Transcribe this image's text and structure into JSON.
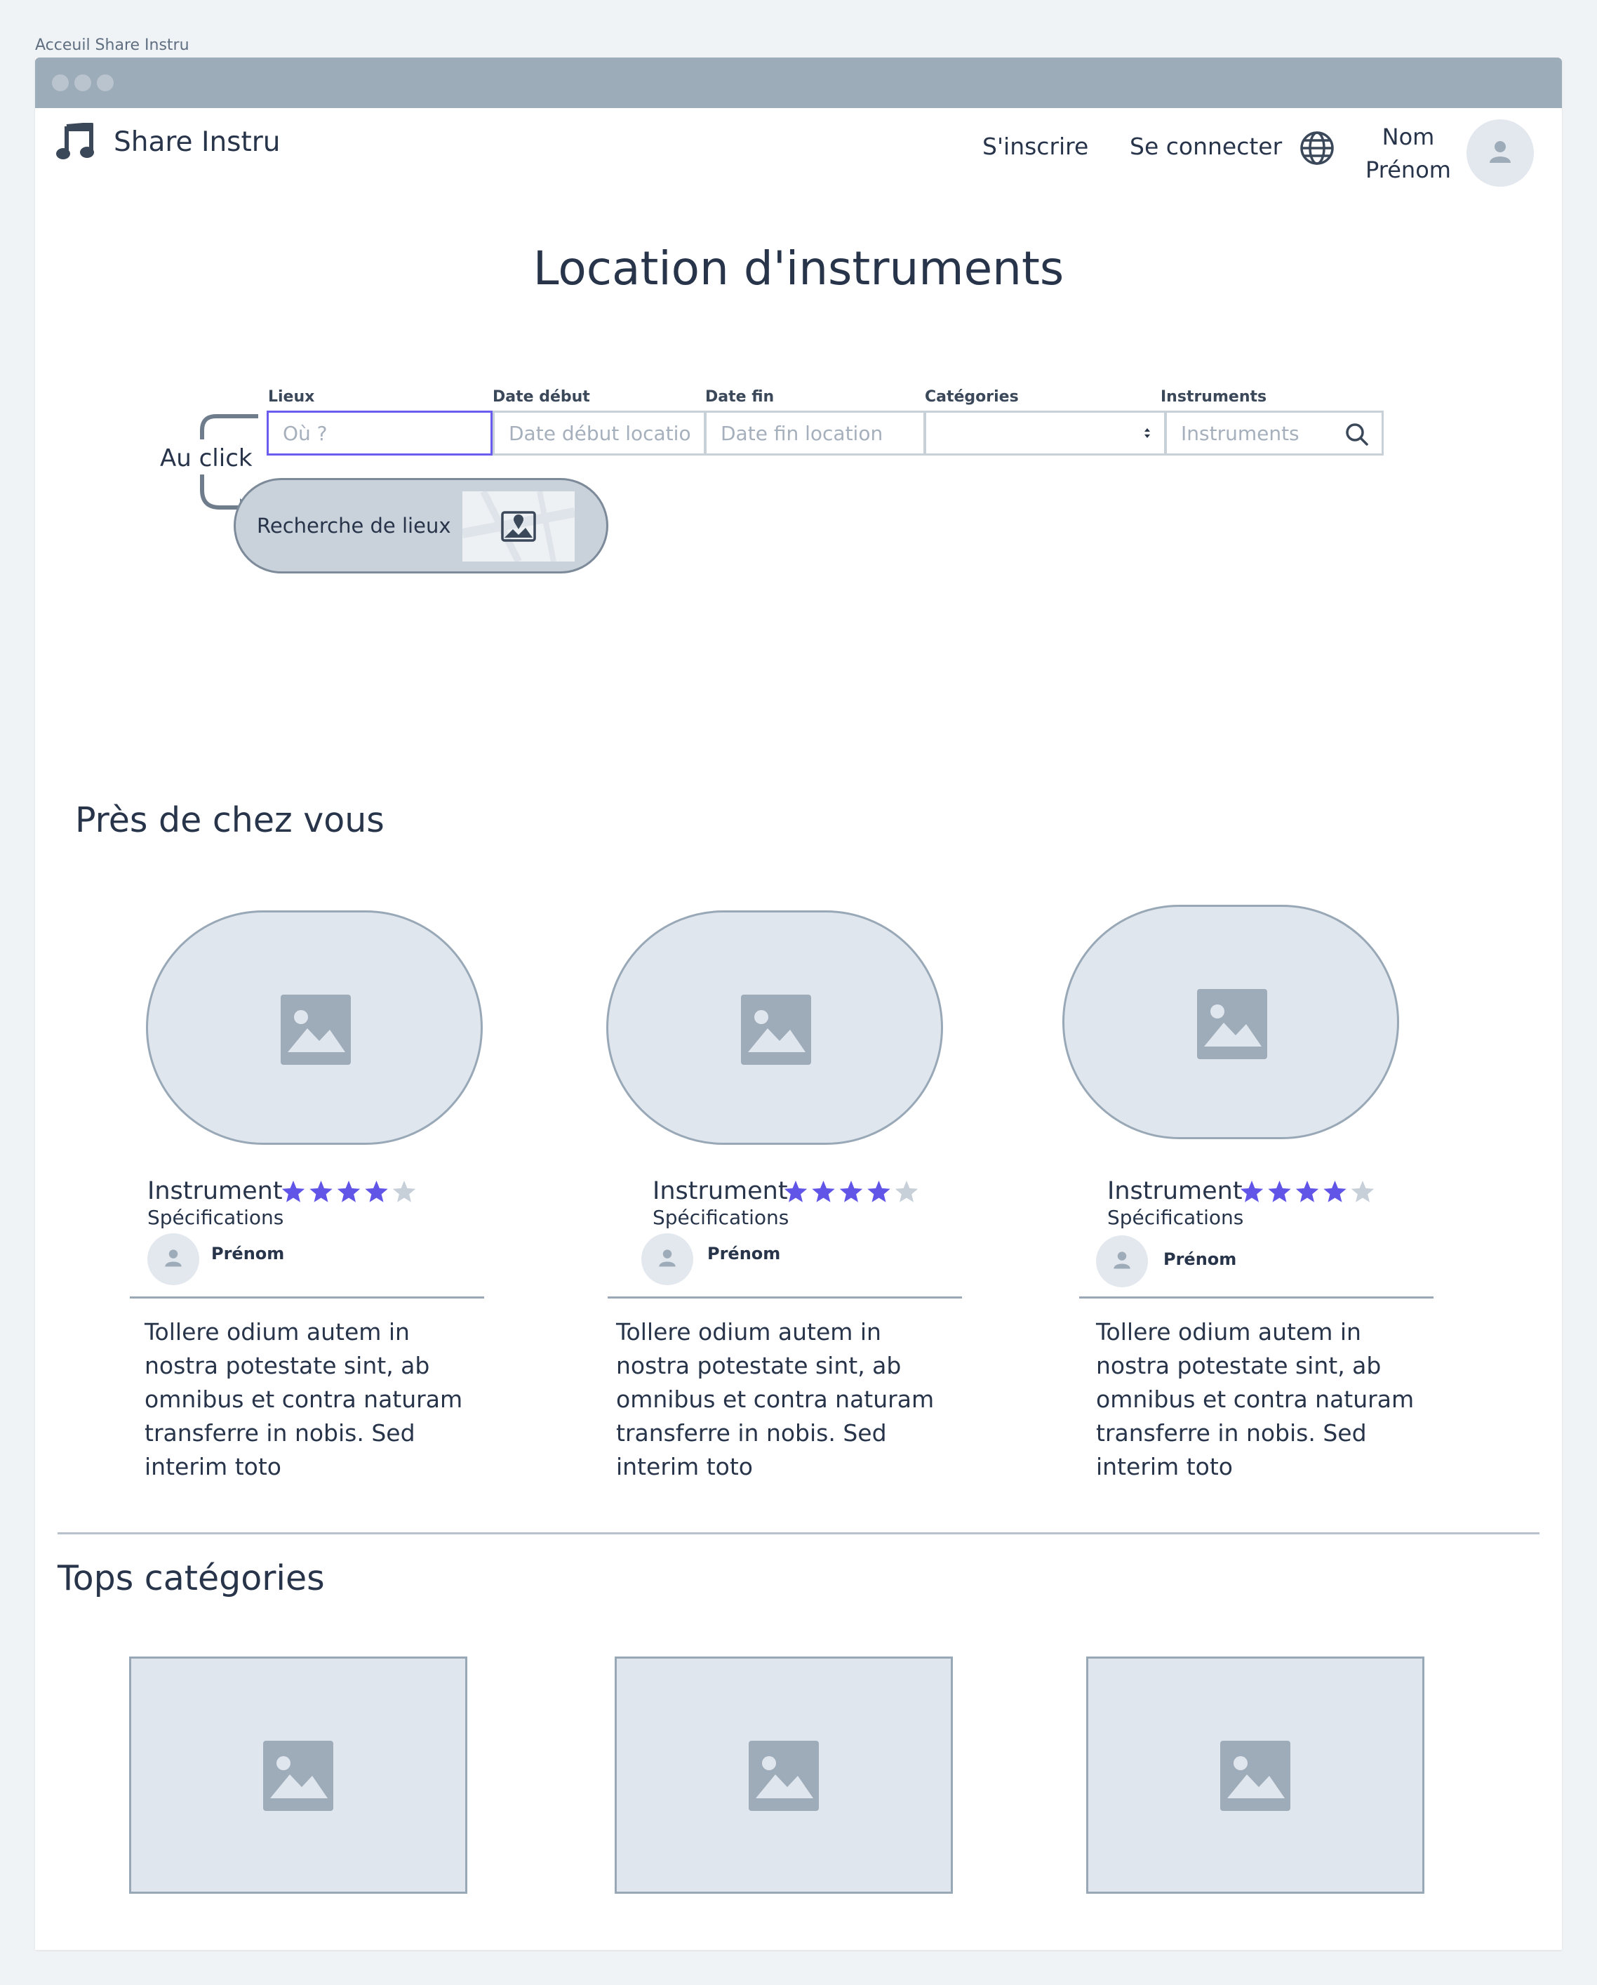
{
  "frame": {
    "title": "Acceuil Share Instru"
  },
  "header": {
    "brand": "Share Instru",
    "brand_icon": "music-note-icon",
    "signup": "S'inscrire",
    "login": "Se connecter",
    "language_icon": "globe-icon",
    "user_first": "Nom",
    "user_second": "Prénom",
    "avatar_icon": "user-icon"
  },
  "hero": {
    "title": "Location d'instruments"
  },
  "search": {
    "labels": {
      "lieux": "Lieux",
      "date_debut": "Date début",
      "date_fin": "Date fin",
      "categories": "Catégories",
      "instruments": "Instruments"
    },
    "placeholders": {
      "lieux": "Où ?",
      "date_debut": "Date début location",
      "date_fin": "Date fin location",
      "instruments": "Instruments"
    },
    "categories_value": ""
  },
  "annotation": {
    "trigger": "Au click",
    "popup_label": "Recherche de lieux"
  },
  "nearby": {
    "title": "Près de chez vous",
    "cards": [
      {
        "name": "Instrument",
        "rating": 4,
        "max_rating": 5,
        "specs": "Spécifications",
        "owner": "Prénom",
        "description": "Tollere odium autem in nostra potestate sint, ab omnibus et contra naturam transferre in nobis. Sed interim toto"
      },
      {
        "name": "Instrument",
        "rating": 4,
        "max_rating": 5,
        "specs": "Spécifications",
        "owner": "Prénom",
        "description": "Tollere odium autem in nostra potestate sint, ab omnibus et contra naturam transferre in nobis. Sed interim toto"
      },
      {
        "name": "Instrument",
        "rating": 4,
        "max_rating": 5,
        "specs": "Spécifications",
        "owner": "Prénom",
        "description": "Tollere odium autem in nostra potestate sint, ab omnibus et contra naturam transferre in nobis. Sed interim toto"
      }
    ]
  },
  "top_categories": {
    "title": "Tops catégories",
    "tiles": 3
  },
  "colors": {
    "accent": "#6b5cf0",
    "star_filled": "#6155e8",
    "star_empty": "#c7cfd8",
    "titlebar": "#9dacb9",
    "placeholder_fill": "#e0e6ee",
    "placeholder_icon": "#9eabb8"
  }
}
